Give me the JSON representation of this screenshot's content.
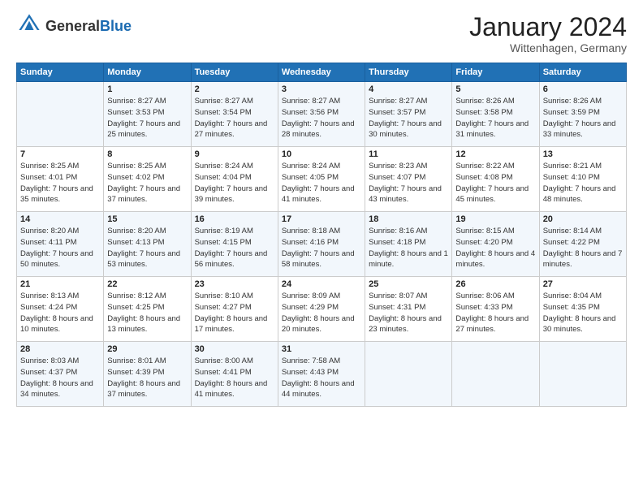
{
  "logo": {
    "general": "General",
    "blue": "Blue"
  },
  "title": "January 2024",
  "location": "Wittenhagen, Germany",
  "days_header": [
    "Sunday",
    "Monday",
    "Tuesday",
    "Wednesday",
    "Thursday",
    "Friday",
    "Saturday"
  ],
  "weeks": [
    [
      {
        "day": "",
        "sunrise": "",
        "sunset": "",
        "daylight": ""
      },
      {
        "day": "1",
        "sunrise": "Sunrise: 8:27 AM",
        "sunset": "Sunset: 3:53 PM",
        "daylight": "Daylight: 7 hours and 25 minutes."
      },
      {
        "day": "2",
        "sunrise": "Sunrise: 8:27 AM",
        "sunset": "Sunset: 3:54 PM",
        "daylight": "Daylight: 7 hours and 27 minutes."
      },
      {
        "day": "3",
        "sunrise": "Sunrise: 8:27 AM",
        "sunset": "Sunset: 3:56 PM",
        "daylight": "Daylight: 7 hours and 28 minutes."
      },
      {
        "day": "4",
        "sunrise": "Sunrise: 8:27 AM",
        "sunset": "Sunset: 3:57 PM",
        "daylight": "Daylight: 7 hours and 30 minutes."
      },
      {
        "day": "5",
        "sunrise": "Sunrise: 8:26 AM",
        "sunset": "Sunset: 3:58 PM",
        "daylight": "Daylight: 7 hours and 31 minutes."
      },
      {
        "day": "6",
        "sunrise": "Sunrise: 8:26 AM",
        "sunset": "Sunset: 3:59 PM",
        "daylight": "Daylight: 7 hours and 33 minutes."
      }
    ],
    [
      {
        "day": "7",
        "sunrise": "Sunrise: 8:25 AM",
        "sunset": "Sunset: 4:01 PM",
        "daylight": "Daylight: 7 hours and 35 minutes."
      },
      {
        "day": "8",
        "sunrise": "Sunrise: 8:25 AM",
        "sunset": "Sunset: 4:02 PM",
        "daylight": "Daylight: 7 hours and 37 minutes."
      },
      {
        "day": "9",
        "sunrise": "Sunrise: 8:24 AM",
        "sunset": "Sunset: 4:04 PM",
        "daylight": "Daylight: 7 hours and 39 minutes."
      },
      {
        "day": "10",
        "sunrise": "Sunrise: 8:24 AM",
        "sunset": "Sunset: 4:05 PM",
        "daylight": "Daylight: 7 hours and 41 minutes."
      },
      {
        "day": "11",
        "sunrise": "Sunrise: 8:23 AM",
        "sunset": "Sunset: 4:07 PM",
        "daylight": "Daylight: 7 hours and 43 minutes."
      },
      {
        "day": "12",
        "sunrise": "Sunrise: 8:22 AM",
        "sunset": "Sunset: 4:08 PM",
        "daylight": "Daylight: 7 hours and 45 minutes."
      },
      {
        "day": "13",
        "sunrise": "Sunrise: 8:21 AM",
        "sunset": "Sunset: 4:10 PM",
        "daylight": "Daylight: 7 hours and 48 minutes."
      }
    ],
    [
      {
        "day": "14",
        "sunrise": "Sunrise: 8:20 AM",
        "sunset": "Sunset: 4:11 PM",
        "daylight": "Daylight: 7 hours and 50 minutes."
      },
      {
        "day": "15",
        "sunrise": "Sunrise: 8:20 AM",
        "sunset": "Sunset: 4:13 PM",
        "daylight": "Daylight: 7 hours and 53 minutes."
      },
      {
        "day": "16",
        "sunrise": "Sunrise: 8:19 AM",
        "sunset": "Sunset: 4:15 PM",
        "daylight": "Daylight: 7 hours and 56 minutes."
      },
      {
        "day": "17",
        "sunrise": "Sunrise: 8:18 AM",
        "sunset": "Sunset: 4:16 PM",
        "daylight": "Daylight: 7 hours and 58 minutes."
      },
      {
        "day": "18",
        "sunrise": "Sunrise: 8:16 AM",
        "sunset": "Sunset: 4:18 PM",
        "daylight": "Daylight: 8 hours and 1 minute."
      },
      {
        "day": "19",
        "sunrise": "Sunrise: 8:15 AM",
        "sunset": "Sunset: 4:20 PM",
        "daylight": "Daylight: 8 hours and 4 minutes."
      },
      {
        "day": "20",
        "sunrise": "Sunrise: 8:14 AM",
        "sunset": "Sunset: 4:22 PM",
        "daylight": "Daylight: 8 hours and 7 minutes."
      }
    ],
    [
      {
        "day": "21",
        "sunrise": "Sunrise: 8:13 AM",
        "sunset": "Sunset: 4:24 PM",
        "daylight": "Daylight: 8 hours and 10 minutes."
      },
      {
        "day": "22",
        "sunrise": "Sunrise: 8:12 AM",
        "sunset": "Sunset: 4:25 PM",
        "daylight": "Daylight: 8 hours and 13 minutes."
      },
      {
        "day": "23",
        "sunrise": "Sunrise: 8:10 AM",
        "sunset": "Sunset: 4:27 PM",
        "daylight": "Daylight: 8 hours and 17 minutes."
      },
      {
        "day": "24",
        "sunrise": "Sunrise: 8:09 AM",
        "sunset": "Sunset: 4:29 PM",
        "daylight": "Daylight: 8 hours and 20 minutes."
      },
      {
        "day": "25",
        "sunrise": "Sunrise: 8:07 AM",
        "sunset": "Sunset: 4:31 PM",
        "daylight": "Daylight: 8 hours and 23 minutes."
      },
      {
        "day": "26",
        "sunrise": "Sunrise: 8:06 AM",
        "sunset": "Sunset: 4:33 PM",
        "daylight": "Daylight: 8 hours and 27 minutes."
      },
      {
        "day": "27",
        "sunrise": "Sunrise: 8:04 AM",
        "sunset": "Sunset: 4:35 PM",
        "daylight": "Daylight: 8 hours and 30 minutes."
      }
    ],
    [
      {
        "day": "28",
        "sunrise": "Sunrise: 8:03 AM",
        "sunset": "Sunset: 4:37 PM",
        "daylight": "Daylight: 8 hours and 34 minutes."
      },
      {
        "day": "29",
        "sunrise": "Sunrise: 8:01 AM",
        "sunset": "Sunset: 4:39 PM",
        "daylight": "Daylight: 8 hours and 37 minutes."
      },
      {
        "day": "30",
        "sunrise": "Sunrise: 8:00 AM",
        "sunset": "Sunset: 4:41 PM",
        "daylight": "Daylight: 8 hours and 41 minutes."
      },
      {
        "day": "31",
        "sunrise": "Sunrise: 7:58 AM",
        "sunset": "Sunset: 4:43 PM",
        "daylight": "Daylight: 8 hours and 44 minutes."
      },
      {
        "day": "",
        "sunrise": "",
        "sunset": "",
        "daylight": ""
      },
      {
        "day": "",
        "sunrise": "",
        "sunset": "",
        "daylight": ""
      },
      {
        "day": "",
        "sunrise": "",
        "sunset": "",
        "daylight": ""
      }
    ]
  ]
}
